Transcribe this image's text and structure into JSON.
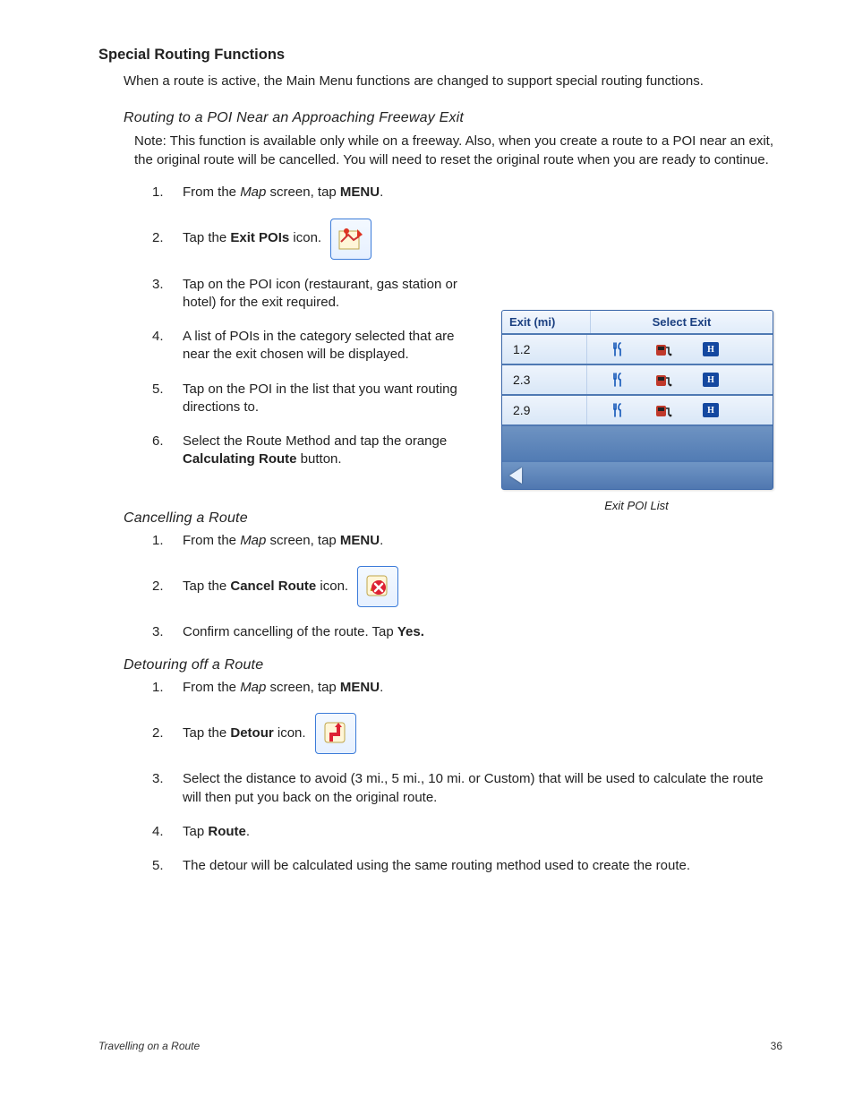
{
  "headings": {
    "main": "Special Routing Functions",
    "sub1": "Routing to a POI Near an Approaching Freeway Exit",
    "sub2": "Cancelling a Route",
    "sub3": "Detouring off a Route"
  },
  "intro": "When a route is active, the Main Menu functions are changed to support special routing functions.",
  "note1": "Note: This function is available only while on a freeway.  Also, when you create a route to a POI near an exit, the original route will be cancelled.  You will need to reset the original route when you are ready to continue.",
  "sec1": {
    "s1_pre": "From the ",
    "s1_map": "Map",
    "s1_mid": " screen, tap ",
    "s1_menu": "MENU",
    "s1_post": ".",
    "s2_pre": "Tap the ",
    "s2_bold": "Exit POIs",
    "s2_post": " icon.",
    "s3": "Tap on the POI icon (restaurant, gas station or hotel) for the exit required.",
    "s4": "A list of POIs in the category selected that are near the exit chosen will be displayed.",
    "s5": "Tap on the POI in the list that you want routing directions to.",
    "s6_pre": "Select the Route Method and tap the orange ",
    "s6_bold": "Calculating Route",
    "s6_post": " button."
  },
  "sec2": {
    "s1_pre": "From the ",
    "s1_map": "Map",
    "s1_mid": " screen, tap ",
    "s1_menu": "MENU",
    "s1_post": ".",
    "s2_pre": "Tap the ",
    "s2_bold": "Cancel Route",
    "s2_post": " icon.",
    "s3_pre": "Confirm cancelling of the route.  Tap ",
    "s3_bold": "Yes."
  },
  "sec3": {
    "s1_pre": "From the ",
    "s1_map": "Map",
    "s1_mid": " screen, tap ",
    "s1_menu": "MENU",
    "s1_post": ".",
    "s2_pre": "Tap the ",
    "s2_bold": "Detour",
    "s2_post": " icon.",
    "s3": "Select the distance to avoid (3 mi., 5 mi., 10 mi. or Custom) that will be used to calculate the route will then put you back on the original route.",
    "s4_pre": "Tap ",
    "s4_bold": "Route",
    "s4_post": ".",
    "s5": "The detour will be calculated using the same routing method used to create the route."
  },
  "figure": {
    "header_left": "Exit (mi)",
    "header_right": "Select Exit",
    "rows": [
      {
        "dist": "1.2"
      },
      {
        "dist": "2.3"
      },
      {
        "dist": "2.9"
      }
    ],
    "caption": "Exit POI List",
    "icons": {
      "restaurant": "restaurant-icon",
      "gas": "gas-station-icon",
      "hotel": "hotel-icon"
    }
  },
  "nums": {
    "n1": "1.",
    "n2": "2.",
    "n3": "3.",
    "n4": "4.",
    "n5": "5.",
    "n6": "6."
  },
  "footer": {
    "section": "Travelling on a Route",
    "page": "36"
  }
}
